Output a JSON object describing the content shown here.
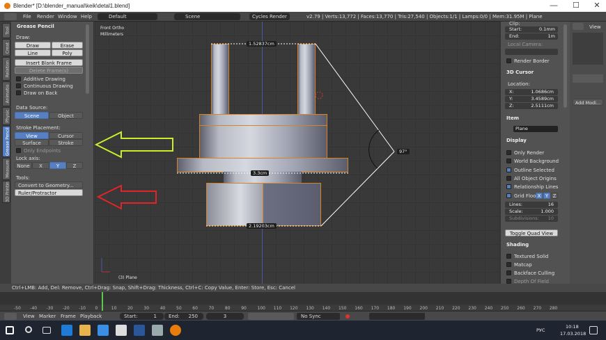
{
  "window": {
    "title": "Blender* [D:\\blender_manual\\keik\\detal1.blend]",
    "min": "—",
    "max": "☐",
    "close": "✕"
  },
  "menubar": {
    "items": [
      "File",
      "Render",
      "Window",
      "Help"
    ],
    "layout": "Default",
    "scene": "Scene",
    "engine": "Cycles Render",
    "stats": "v2.79 | Verts:13,772 | Faces:13,770 | Tris:27,540 | Objects:1/1 | Lamps:0/0 | Mem:31.95M | Plane"
  },
  "tabs": [
    "Tool",
    "Creat",
    "Relation",
    "Animatio",
    "Physic",
    "Grease Pencil",
    "Measure",
    "3D Printin"
  ],
  "toolshelf": {
    "header": "Grease Pencil",
    "draw_label": "Draw:",
    "draw": "Draw",
    "erase": "Erase",
    "line": "Line",
    "poly": "Poly",
    "insert_blank": "Insert Blank Frame",
    "delete_frames": "Delete Frame(s)",
    "additive": "Additive Drawing",
    "continuous": "Continuous Drawing",
    "draw_on_back": "Draw on Back",
    "data_source_label": "Data Source:",
    "scene": "Scene",
    "object": "Object",
    "stroke_placement_label": "Stroke Placement:",
    "view": "View",
    "cursor": "Cursor",
    "surface": "Surface",
    "stroke": "Stroke",
    "only_endpoints": "Only Endpoints",
    "lock_axis_label": "Lock axis:",
    "lock_axes": [
      "None",
      "X",
      "Y",
      "Z"
    ],
    "tools_label": "Tools:",
    "convert": "Convert to Geometry...",
    "ruler": "Ruler/Protractor"
  },
  "viewport": {
    "view_label": "Front Ortho",
    "units_label": "Millimeters",
    "object_label": "(3) Plane",
    "measures": {
      "top": "1.52837cm",
      "middle": "3.3cm",
      "bottom": "2.19203cm",
      "angle": "97°"
    }
  },
  "props": {
    "clip_label": "Clip:",
    "start_label": "Start:",
    "start": "0.1mm",
    "end_label": "End:",
    "end": "1m",
    "local_camera": "Local Camera:",
    "render_border": "Render Border",
    "cursor_header": "3D Cursor",
    "location_label": "Location:",
    "x_label": "X:",
    "x": "1.0686cm",
    "y_label": "Y:",
    "y": "3.4589cm",
    "z_label": "Z:",
    "z": "2.5111cm",
    "item_header": "Item",
    "item_name": "Plane",
    "display_header": "Display",
    "only_render": "Only Render",
    "world_bg": "World Background",
    "outline_selected": "Outline Selected",
    "all_origins": "All Object Origins",
    "relationship_lines": "Relationship Lines",
    "grid_floor": "Grid Floo",
    "grid_axes": [
      "X",
      "Y",
      "Z"
    ],
    "lines_label": "Lines:",
    "lines": "16",
    "scale_label": "Scale:",
    "scale": "1.000",
    "subdiv_label": "Subdivisions:",
    "subdiv": "10",
    "quad_view": "Toggle Quad View",
    "shading_header": "Shading",
    "textured_solid": "Textured Solid",
    "matcap": "Matcap",
    "backface": "Backface Culling",
    "dof": "Depth Of Field"
  },
  "outliner": {
    "view": "View",
    "add_modifier": "Add Modi..."
  },
  "statusbar": "Ctrl+LMB: Add, Del: Remove, Ctrl+Drag: Snap, Shift+Drag: Thickness, Ctrl+C: Copy Value, Enter: Store,  Esc: Cancel",
  "timeline": {
    "ticks": [
      "-50",
      "-40",
      "-30",
      "-20",
      "-10",
      "0",
      "10",
      "20",
      "30",
      "40",
      "50",
      "60",
      "70",
      "80",
      "90",
      "100",
      "110",
      "120",
      "130",
      "140",
      "150",
      "160",
      "170",
      "180",
      "190",
      "200",
      "210",
      "220",
      "230",
      "240",
      "250",
      "260",
      "270",
      "280"
    ],
    "menu": [
      "View",
      "Marker",
      "Frame",
      "Playback"
    ],
    "start_label": "Start:",
    "start": "1",
    "end_label": "End:",
    "end": "250",
    "current": "3",
    "sync": "No Sync"
  },
  "taskbar": {
    "lang": "РУС",
    "time": "10:18",
    "date": "17.03.2018"
  }
}
